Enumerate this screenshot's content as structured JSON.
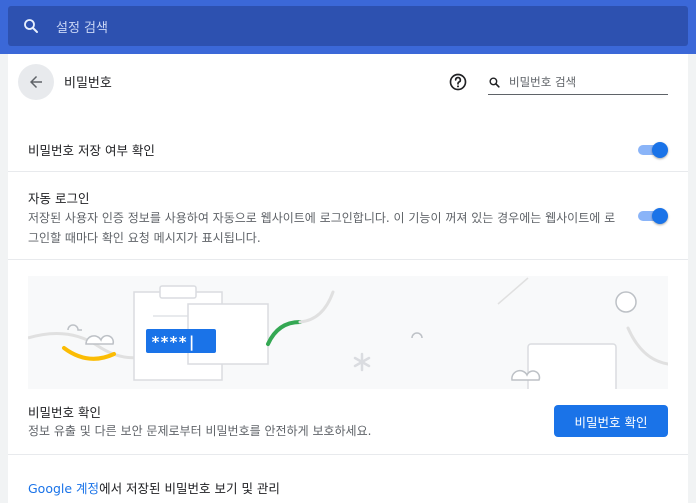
{
  "search": {
    "placeholder": "설정 검색"
  },
  "header": {
    "title": "비밀번호",
    "search_placeholder": "비밀번호 검색"
  },
  "offer_to_save": {
    "label": "비밀번호 저장 여부 확인",
    "enabled": true
  },
  "auto_signin": {
    "title": "자동 로그인",
    "description": "저장된 사용자 인증 정보를 사용하여 자동으로 웹사이트에 로그인합니다. 이 기능이 꺼져 있는 경우에는 웹사이트에 로그인할 때마다 확인 요청 메시지가 표시됩니다.",
    "enabled": true
  },
  "illustration": {
    "password_mask": "****|"
  },
  "password_check": {
    "title": "비밀번호 확인",
    "description": "정보 유출 및 다른 보안 문제로부터 비밀번호를 안전하게 보호하세요.",
    "button_label": "비밀번호 확인"
  },
  "footer": {
    "link_text": "Google 계정",
    "text_rest": "에서 저장된 비밀번호 보기 및 관리"
  },
  "colors": {
    "accent": "#1a73e8",
    "topbar": "#3b68d8",
    "searchbox": "#2d51b0"
  },
  "icons": {
    "search": "search-icon",
    "back": "arrow-back-icon",
    "help": "help-icon"
  }
}
